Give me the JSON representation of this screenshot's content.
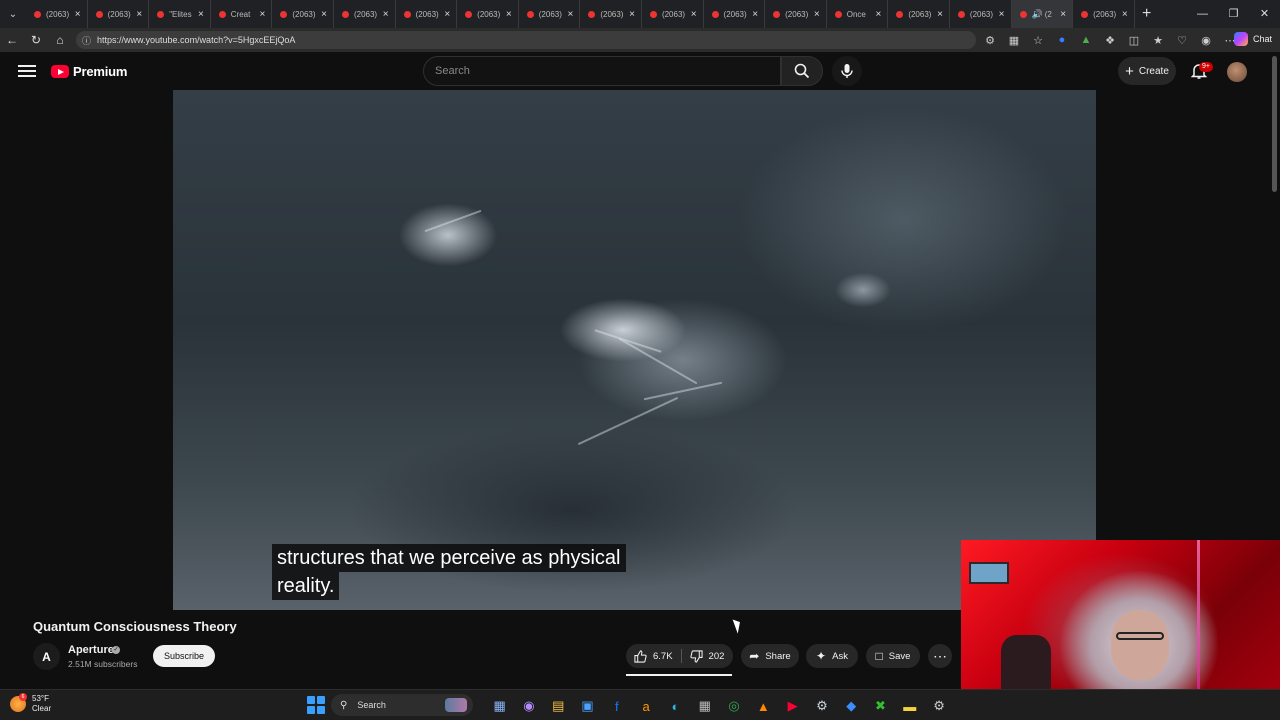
{
  "browser": {
    "tabs": [
      {
        "title": "(2063)",
        "active": false
      },
      {
        "title": "(2063)",
        "active": false
      },
      {
        "title": "\"Elites",
        "active": false
      },
      {
        "title": "Creat",
        "active": false
      },
      {
        "title": "(2063)",
        "active": false
      },
      {
        "title": "(2063)",
        "active": false
      },
      {
        "title": "(2063)",
        "active": false
      },
      {
        "title": "(2063)",
        "active": false
      },
      {
        "title": "(2063)",
        "active": false
      },
      {
        "title": "(2063)",
        "active": false
      },
      {
        "title": "(2063)",
        "active": false
      },
      {
        "title": "(2063)",
        "active": false
      },
      {
        "title": "(2063)",
        "active": false
      },
      {
        "title": "Once",
        "active": false
      },
      {
        "title": "(2063)",
        "active": false
      },
      {
        "title": "(2063)",
        "active": false
      },
      {
        "title": "(2",
        "active": true
      },
      {
        "title": "(2063)",
        "active": false
      }
    ],
    "url": "https://www.youtube.com/watch?v=5HgxcEEjQoA",
    "copilot_label": "Chat"
  },
  "youtube": {
    "logo_text": "Premium",
    "search_placeholder": "Search",
    "create_label": "Create",
    "notification_count": "9+"
  },
  "video": {
    "caption_line1": "structures that we perceive as physical",
    "caption_line2": "reality.",
    "title": "Quantum Consciousness Theory",
    "channel_initial": "A",
    "channel_name": "Aperture",
    "subscribers": "2.51M subscribers",
    "subscribe_label": "Subscribe",
    "likes": "6.7K",
    "dislikes": "202",
    "share_label": "Share",
    "ask_label": "Ask",
    "save_label": "Save"
  },
  "taskbar": {
    "temperature": "53°F",
    "condition": "Clear",
    "weather_badge": "6",
    "search_label": "Search",
    "apps": [
      "file-explorer-icon",
      "copilot-icon",
      "folder-icon",
      "store-icon",
      "facebook-icon",
      "amazon-icon",
      "edge-icon",
      "calculator-icon",
      "chrome-icon",
      "vlc-icon",
      "youtube-icon",
      "steam-icon",
      "app-icon",
      "xbox-icon",
      "notes-icon",
      "settings-icon"
    ]
  },
  "colors": {
    "youtube_red": "#ff0033",
    "background": "#0f0f0f",
    "pill": "#272727"
  }
}
